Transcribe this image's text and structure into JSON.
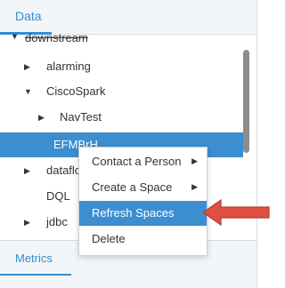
{
  "top_tab": {
    "label": "Data",
    "accent": "#2f8fcc"
  },
  "tree": {
    "items": [
      {
        "label": "downstream",
        "expanded": true
      },
      {
        "label": "alarming",
        "expanded": false
      },
      {
        "label": "CiscoSpark",
        "expanded": true
      },
      {
        "label": "NavTest",
        "expanded": false
      },
      {
        "label": "EFMBrH",
        "selected": true
      },
      {
        "label": "dataflov",
        "expanded": false
      },
      {
        "label": "DQL"
      },
      {
        "label": "jdbc",
        "expanded": false
      }
    ]
  },
  "context_menu": {
    "items": [
      {
        "label": "Contact a Person",
        "has_submenu": true
      },
      {
        "label": "Create a Space",
        "has_submenu": true
      },
      {
        "label": "Refresh Spaces",
        "active": true
      },
      {
        "label": "Delete"
      }
    ],
    "active_color": "#3c8ed0"
  },
  "bottom_tab": {
    "label": "Metrics",
    "accent": "#2f8fcc"
  },
  "pointer": {
    "icon": "red-pointer-arrow-icon",
    "color": "#e04f43"
  }
}
